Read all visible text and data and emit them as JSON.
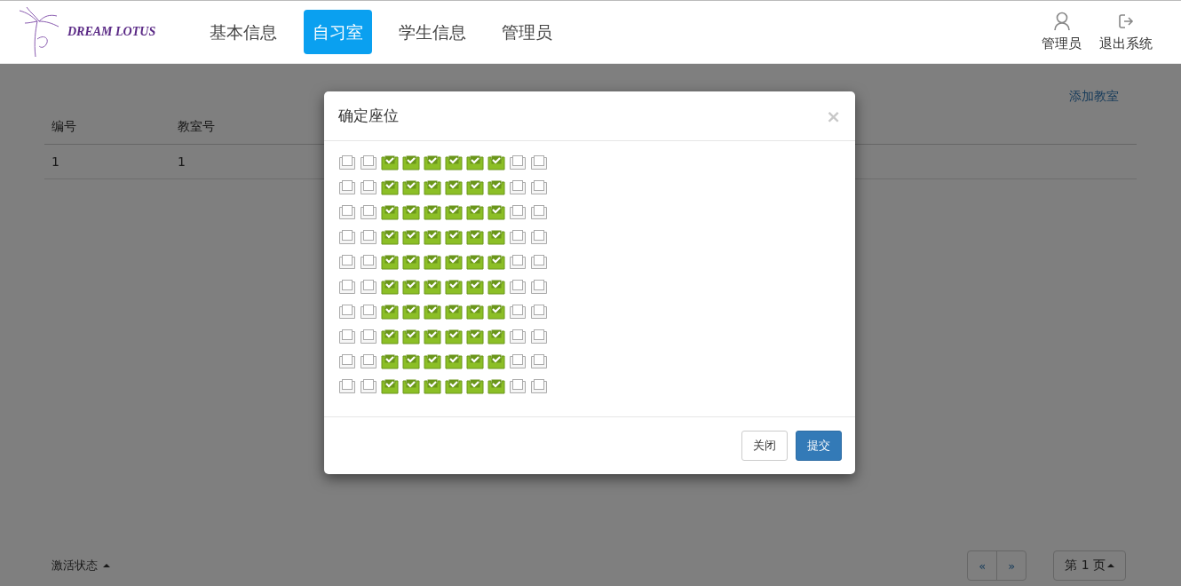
{
  "header": {
    "logo_text": "DREAM LOTUS",
    "nav": [
      {
        "label": "基本信息",
        "selected": false
      },
      {
        "label": "自习室",
        "selected": true
      },
      {
        "label": "学生信息",
        "selected": false
      },
      {
        "label": "管理员",
        "selected": false
      }
    ],
    "user_actions": [
      {
        "kind": "user",
        "label": "管理员"
      },
      {
        "kind": "logout",
        "label": "退出系统"
      }
    ]
  },
  "page": {
    "add_link": "添加教室",
    "table": {
      "columns": [
        "编号",
        "教室号"
      ],
      "rows": [
        [
          "1",
          "1"
        ]
      ]
    },
    "filter_label": "激活状态",
    "pager": {
      "prev": "«",
      "next": "»",
      "page_label": "第 1 页"
    }
  },
  "modal": {
    "title": "确定座位",
    "close": "×",
    "seat_rows": [
      [
        false,
        false,
        true,
        true,
        true,
        true,
        true,
        true,
        false,
        false
      ],
      [
        false,
        false,
        true,
        true,
        true,
        true,
        true,
        true,
        false,
        false
      ],
      [
        false,
        false,
        true,
        true,
        true,
        true,
        true,
        true,
        false,
        false
      ],
      [
        false,
        false,
        true,
        true,
        true,
        true,
        true,
        true,
        false,
        false
      ],
      [
        false,
        false,
        true,
        true,
        true,
        true,
        true,
        true,
        false,
        false
      ],
      [
        false,
        false,
        true,
        true,
        true,
        true,
        true,
        true,
        false,
        false
      ],
      [
        false,
        false,
        true,
        true,
        true,
        true,
        true,
        true,
        false,
        false
      ],
      [
        false,
        false,
        true,
        true,
        true,
        true,
        true,
        true,
        false,
        false
      ],
      [
        false,
        false,
        true,
        true,
        true,
        true,
        true,
        true,
        false,
        false
      ],
      [
        false,
        false,
        true,
        true,
        true,
        true,
        true,
        true,
        false,
        false
      ]
    ],
    "buttons": [
      {
        "kind": "default",
        "label": "关闭"
      },
      {
        "kind": "primary",
        "label": "提交"
      }
    ]
  }
}
